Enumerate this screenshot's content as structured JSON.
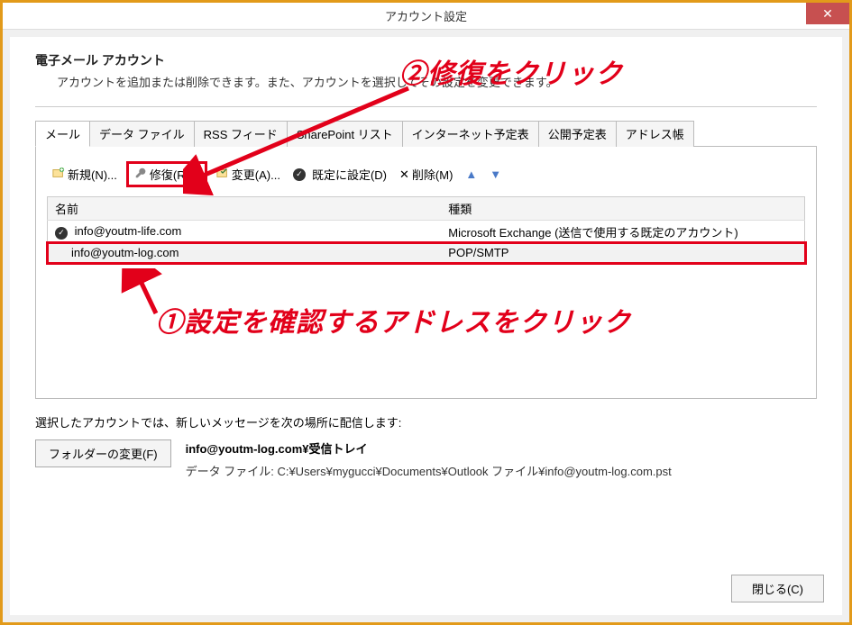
{
  "window": {
    "title": "アカウント設定"
  },
  "header": {
    "heading": "電子メール アカウント",
    "subheading": "アカウントを追加または削除できます。また、アカウントを選択してその設定を変更できます。"
  },
  "tabs": [
    {
      "label": "メール",
      "active": true
    },
    {
      "label": "データ ファイル"
    },
    {
      "label": "RSS フィード"
    },
    {
      "label": "SharePoint リスト"
    },
    {
      "label": "インターネット予定表"
    },
    {
      "label": "公開予定表"
    },
    {
      "label": "アドレス帳"
    }
  ],
  "toolbar": {
    "new": "新規(N)...",
    "repair": "修復(R)...",
    "change": "変更(A)...",
    "set_default": "既定に設定(D)",
    "delete": "削除(M)"
  },
  "columns": {
    "name": "名前",
    "type": "種類"
  },
  "accounts": [
    {
      "is_default": true,
      "name": "info@youtm-life.com",
      "type": "Microsoft Exchange (送信で使用する既定のアカウント)",
      "selected": false,
      "highlighted": false
    },
    {
      "is_default": false,
      "name": "info@youtm-log.com",
      "type": "POP/SMTP",
      "selected": true,
      "highlighted": true
    }
  ],
  "delivery": {
    "label": "選択したアカウントでは、新しいメッセージを次の場所に配信します:",
    "change_folder_btn": "フォルダーの変更(F)",
    "location_bold": "info@youtm-log.com¥受信トレイ",
    "data_file": "データ ファイル: C:¥Users¥mygucci¥Documents¥Outlook ファイル¥info@youtm-log.com.pst"
  },
  "close_button": "閉じる(C)",
  "annotations": {
    "a2": "②修復をクリック",
    "a1": "①設定を確認するアドレスをクリック"
  }
}
